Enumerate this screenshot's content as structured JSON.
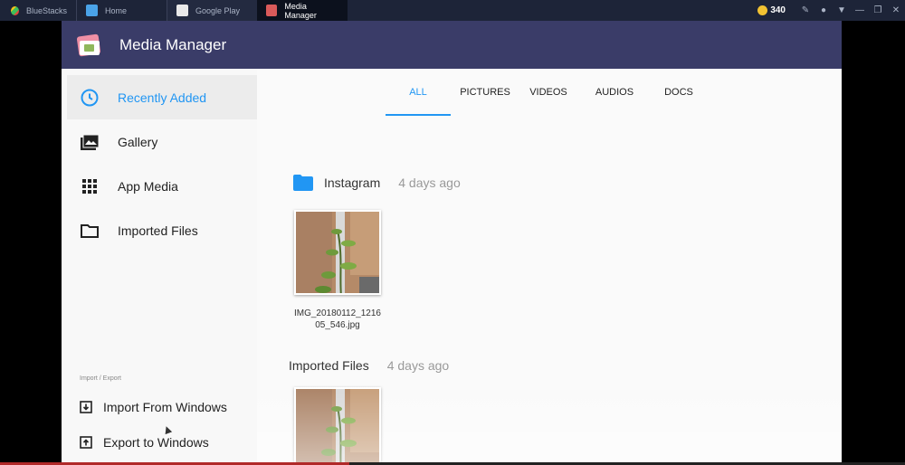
{
  "chrome": {
    "brand": "BlueStacks",
    "tabs": [
      {
        "label": "Home"
      },
      {
        "label": "Google Play"
      },
      {
        "label": "Media Manager"
      }
    ],
    "coins": "340"
  },
  "app": {
    "title": "Media Manager"
  },
  "sidebar": {
    "items": [
      {
        "label": "Recently Added",
        "icon": "clock-icon"
      },
      {
        "label": "Gallery",
        "icon": "gallery-icon"
      },
      {
        "label": "App Media",
        "icon": "grid-icon"
      },
      {
        "label": "Imported Files",
        "icon": "folder-icon"
      }
    ],
    "section_label": "Import / Export",
    "io": [
      {
        "label": "Import From Windows",
        "icon": "import-icon"
      },
      {
        "label": "Export to Windows",
        "icon": "export-icon"
      }
    ]
  },
  "content_tabs": [
    {
      "label": "ALL"
    },
    {
      "label": "PICTURES"
    },
    {
      "label": "VIDEOS"
    },
    {
      "label": "AUDIOS"
    },
    {
      "label": "DOCS"
    }
  ],
  "groups": [
    {
      "name": "Instagram",
      "date": "4 days ago",
      "files": [
        {
          "caption_line1": "IMG_20180112_1216",
          "caption_line2": "05_546.jpg"
        }
      ]
    },
    {
      "name": "Imported Files",
      "date": "4 days ago",
      "files": [
        {}
      ]
    }
  ],
  "colors": {
    "appbar": "#3a3c68",
    "accent": "#2196f3",
    "sidebar": "#f8f8f8"
  }
}
